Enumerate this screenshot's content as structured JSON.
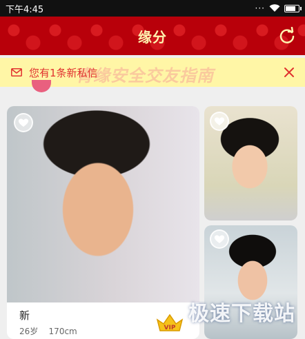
{
  "status_bar": {
    "time": "下午4:45"
  },
  "header": {
    "title": "缘分"
  },
  "notice": {
    "message": "您有1条新私信",
    "watermark": "青缘安全交友指南"
  },
  "cards": {
    "main": {
      "name": "新",
      "age": "26岁",
      "height": "170cm",
      "badge": "VIP"
    }
  },
  "footer_watermark": "极速下载站",
  "colors": {
    "header_bg": "#b8000a",
    "title": "#fff3b0",
    "notice_bg": "#fff6a6",
    "notice_text": "#e0312f"
  }
}
